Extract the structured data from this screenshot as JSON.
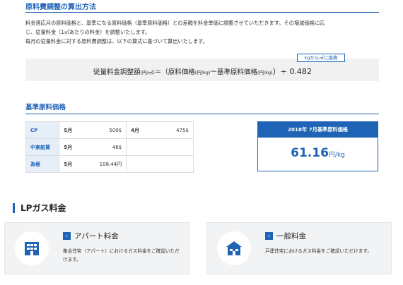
{
  "section": {
    "title": "原料費調整の算出方法",
    "para1_line1": "料金適応月の原料価格と、基準になる原料価格（基準原料価格）との差額を料金単価に調整させていただきます。その増減価格に応",
    "para1_line2": "じ、従量料金（1㎥あたりの料金）を調整いたします。",
    "para2": "毎月の従量料金に対する原料費調整は、以下の算式に基づいて算出いたします。",
    "convert_tag": "kgから㎥に換算",
    "formula": {
      "part1": "従量料金調整額",
      "unit1": "(円/㎥)",
      "part2": "＝（原料価格",
      "unit2": "(円/kg)",
      "part3": "ー基準原料価格",
      "unit3": "(円/kg)",
      "part4": "）÷ 0.482"
    }
  },
  "base_price": {
    "title": "基準原料価格",
    "rows": [
      {
        "head": "CP",
        "l1": "5月",
        "v1": "500$",
        "l2": "4月",
        "v2": "475$"
      },
      {
        "head": "中東船賃",
        "l1": "5月",
        "v1": "46$",
        "l2": "",
        "v2": ""
      },
      {
        "head": "為替",
        "l1": "5月",
        "v1": "108.44円",
        "l2": "",
        "v2": ""
      }
    ],
    "card_header": "2018年 7月基準原料価格",
    "card_value": "61.16",
    "card_unit": "円/kg"
  },
  "lp": {
    "title": "LPガス料金",
    "cards": [
      {
        "name": "アパート料金",
        "desc": "集合住宅（アパート）におけるガス料金をご確認いただけます。",
        "icon": "apartment-icon"
      },
      {
        "name": "一般料金",
        "desc": "戸建住宅におけるガス料金をご確認いただけます。",
        "icon": "house-icon"
      }
    ]
  },
  "colors": {
    "accent": "#1f63b6",
    "panel": "#f1f1f1"
  }
}
